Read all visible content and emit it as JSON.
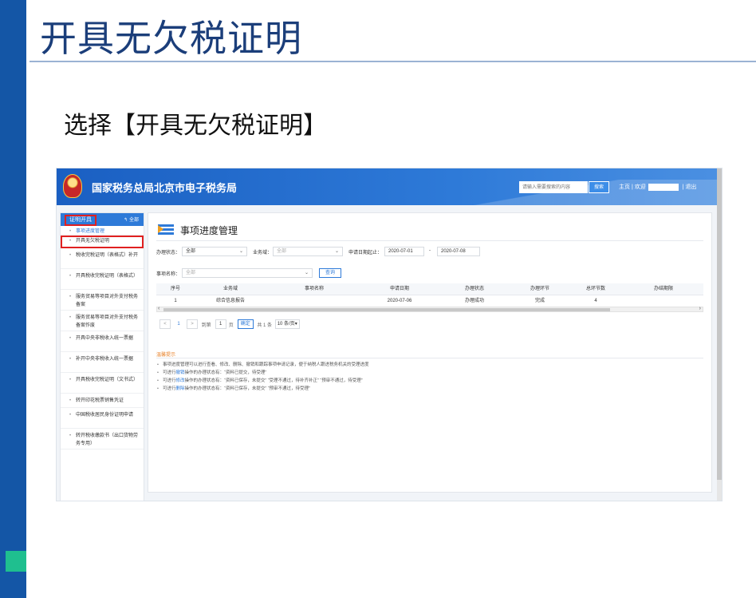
{
  "slide": {
    "title": "开具无欠税证明",
    "subtitle": "选择【开具无欠税证明】"
  },
  "header": {
    "site_name": "国家税务总局北京市电子税务局",
    "search_placeholder": "请输入需要搜索的内容",
    "search_label": "搜索",
    "home_link": "主页",
    "welcome_label": "欢迎",
    "logout_link": "退出"
  },
  "sidebar": {
    "header_label": "证明开具",
    "all_label": "全部",
    "items": [
      {
        "label": "事项进度管理",
        "active": true
      },
      {
        "label": "开具无欠税证明",
        "boxed": true
      },
      {
        "label": "税收完税证明（表格式）补开"
      },
      {
        "label": "开具税收完税证明（表格式）"
      },
      {
        "label": "服务贸易等项目对外支付税务备案"
      },
      {
        "label": "服务贸易等项目对外支付税务备案作废"
      },
      {
        "label": "开具中央非税收入统一票据"
      },
      {
        "label": "补开中央非税收入统一票据"
      },
      {
        "label": "开具税收完税证明（文书式）"
      },
      {
        "label": "转开印花税票销售凭证"
      },
      {
        "label": "中国税收居民身份证明申请"
      },
      {
        "label": "转开税收缴款书（出口货物劳务专用）"
      }
    ]
  },
  "panel": {
    "title": "事项进度管理",
    "filters": {
      "status_label": "办理状态：",
      "status_value": "全部",
      "domain_label": "业务域：",
      "domain_placeholder": "全部",
      "date_label": "申请日期起止：",
      "date_from": "2020-07-01",
      "date_sep": "-",
      "date_to": "2020-07-08",
      "item_label": "事项名称：",
      "item_placeholder": "全部",
      "query_label": "查询"
    },
    "table": {
      "columns": [
        "序号",
        "业务域",
        "事项名称",
        "申请日期",
        "办理状态",
        "办理环节",
        "总环节数",
        "办结期限"
      ],
      "rows": [
        [
          "1",
          "综合信息报告",
          "",
          "2020-07-06",
          "办理成功",
          "完成",
          "4",
          ""
        ]
      ]
    },
    "pager": {
      "prev": "<",
      "current": "1",
      "next": ">",
      "goto_label": "到第",
      "page_input": "1",
      "page_unit": "页",
      "confirm_label": "确定",
      "total": "共 1 条",
      "page_size": "10 条/页"
    },
    "tips": {
      "title": "温馨提示",
      "items": [
        {
          "pre": "事项进度管理可以进行查看、修改、删除、撤销和跟踪事项申请记录，便于纳税人跟进税务机关的受理进度",
          "kw": "",
          "post": ""
        },
        {
          "pre": "可进行",
          "kw": "撤销",
          "post": "操作的办理状态有：“资料已提交，待受理”"
        },
        {
          "pre": "可进行",
          "kw": "修改",
          "post": "操作的办理状态有：“资料已保存，未提交” “受理不通过，待补齐补正” “预审不通过，待受理”"
        },
        {
          "pre": "可进行",
          "kw": "删除",
          "post": "操作的办理状态有：“资料已保存，未提交” “预审不通过，待受理”"
        }
      ]
    }
  },
  "colors": {
    "slide_bar": "#1456a6",
    "slide_accent_green": "#1fbf8f",
    "title_color": "#1b3e7a",
    "header_blue": "#2e7ad8",
    "highlight_box": "#e02020",
    "tips_orange": "#e8832b"
  },
  "icons": {
    "emblem": "national-tax-emblem",
    "list": "list-icon"
  }
}
